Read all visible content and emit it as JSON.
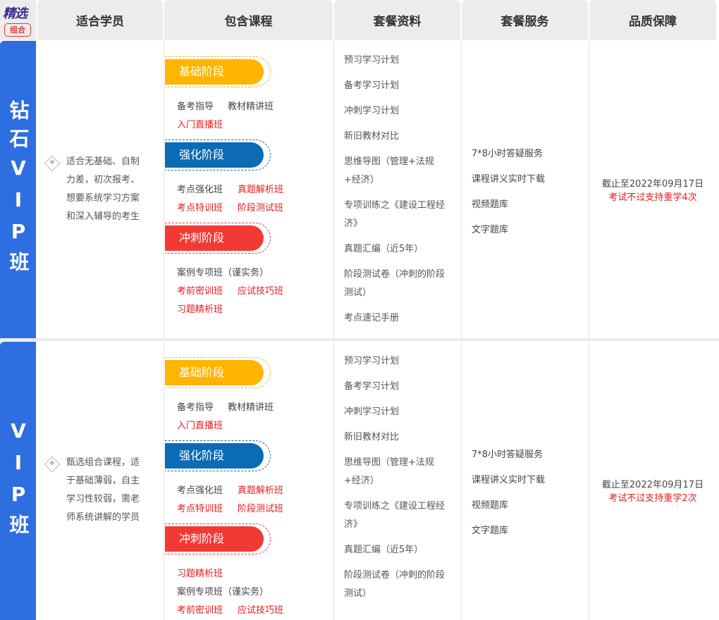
{
  "logo": {
    "top": "精选",
    "badge": "组合"
  },
  "headers": [
    "适合学员",
    "包含课程",
    "套餐资料",
    "套餐服务",
    "品质保障"
  ],
  "stages": {
    "basic": "基础阶段",
    "strengthen": "强化阶段",
    "sprint": "冲刺阶段"
  },
  "colors": {
    "basic": "#ffb400",
    "strengthen": "#0b6bb5",
    "sprint": "#f23a35",
    "tier": "#2d6ee0",
    "red": "#e41c1c"
  },
  "rows": [
    {
      "tier": "钻石VIP班",
      "who": "适合无基础、自制力差，初次报考、想要系统学习方案和深入辅导的考生",
      "basic": [
        {
          "text": "备考指导",
          "red": false
        },
        {
          "text": "教材精讲班",
          "red": false
        },
        {
          "text": "入门直播班",
          "red": true
        }
      ],
      "strengthen": [
        {
          "text": "考点强化班",
          "red": false
        },
        {
          "text": "真题解析班",
          "red": true
        },
        {
          "text": "考点特训班",
          "red": true
        },
        {
          "text": "阶段测试班",
          "red": true
        }
      ],
      "sprint": [
        {
          "text": "案例专项班（谨实务）",
          "red": false
        },
        {
          "text": "考前密训班",
          "red": true
        },
        {
          "text": "应试技巧班",
          "red": true
        },
        {
          "text": "习题精析班",
          "red": true
        }
      ],
      "materials": [
        "预习学习计划",
        "备考学习计划",
        "冲刺学习计划",
        "新旧教材对比",
        "思维导图（管理+法规+经济）",
        "专项训练之《建设工程经济》",
        "真题汇编（近5年）",
        "阶段测试卷（冲刺的阶段测试）",
        "考点速记手册"
      ],
      "services": [
        "7*8小时答疑服务",
        "课程讲义实时下载",
        "视频题库",
        "文字题库"
      ],
      "quality": {
        "deadline": "截止至2022年09月17日",
        "retake": "考试不过支持重学4次"
      }
    },
    {
      "tier": "VIP班",
      "who": "甄选组合课程，适于基础薄弱，自主学习性较弱，需老师系统讲解的学员",
      "basic": [
        {
          "text": "备考指导",
          "red": false
        },
        {
          "text": "教材精讲班",
          "red": false
        },
        {
          "text": "入门直播班",
          "red": true
        }
      ],
      "strengthen": [
        {
          "text": "考点强化班",
          "red": false
        },
        {
          "text": "真题解析班",
          "red": true
        },
        {
          "text": "考点特训班",
          "red": true
        },
        {
          "text": "阶段测试班",
          "red": true
        }
      ],
      "sprint": [
        {
          "text": "习题精析班",
          "red": true
        },
        {
          "text": "案例专项班（谨实务）",
          "red": false
        },
        {
          "text": "考前密训班",
          "red": true
        },
        {
          "text": "应试技巧班",
          "red": true
        }
      ],
      "materials": [
        "预习学习计划",
        "备考学习计划",
        "冲刺学习计划",
        "新旧教材对比",
        "思维导图（管理+法规+经济）",
        "专项训练之《建设工程经济》",
        "真题汇编（近5年）",
        "阶段测试卷（冲刺的阶段测试）"
      ],
      "services": [
        "7*8小时答疑服务",
        "课程讲义实时下载",
        "视频题库",
        "文字题库"
      ],
      "quality": {
        "deadline": "截止至2022年09月17日",
        "retake": "考试不过支持重学2次"
      }
    }
  ]
}
